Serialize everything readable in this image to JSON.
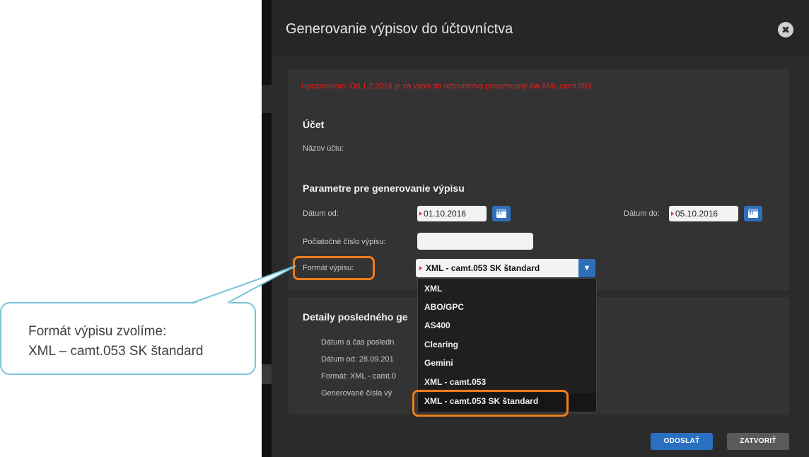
{
  "modal": {
    "title": "Generovanie výpisov do účtovníctva",
    "close_glyph": "✖",
    "warning": "Upozornenie: Od 1.2.2016 je za výpis do účtovníctva považovaný iba XML camt.053.",
    "account_section": {
      "title": "Účet",
      "account_name_label": "Názov účtu:"
    },
    "params_section": {
      "title": "Parametre pre generovanie výpisu",
      "date_from_label": "Dátum od:",
      "date_from_value": "01.10.2016",
      "date_to_label": "Dátum do:",
      "date_to_value": "05.10.2016",
      "start_number_label": "Počiatočné číslo výpisu:",
      "start_number_value": "",
      "format_label": "Formát výpisu:",
      "format_selected": "XML - camt.053 SK štandard",
      "format_options": [
        "XML",
        "ABO/GPC",
        "AS400",
        "Clearing",
        "Gemini",
        "XML - camt.053",
        "XML - camt.053 SK štandard"
      ]
    },
    "last_details": {
      "title": "Detaily posledného ge",
      "line1": "Dátum a čas posledn",
      "line2": "Dátum od:  28.09.201",
      "line3": "Formát:  XML - camt.0",
      "line4": "Generované čísla vý"
    },
    "buttons": {
      "send": "ODOSLAŤ",
      "close": "ZATVORIŤ"
    }
  },
  "callout": {
    "line1": "Formát výpisu zvolíme:",
    "line2": "XML – camt.053 SK štandard"
  },
  "colors": {
    "highlight": "#f07d1a",
    "callout_border": "#7bc2d8",
    "warning": "#e0231e",
    "accent": "#2a6fc0"
  }
}
